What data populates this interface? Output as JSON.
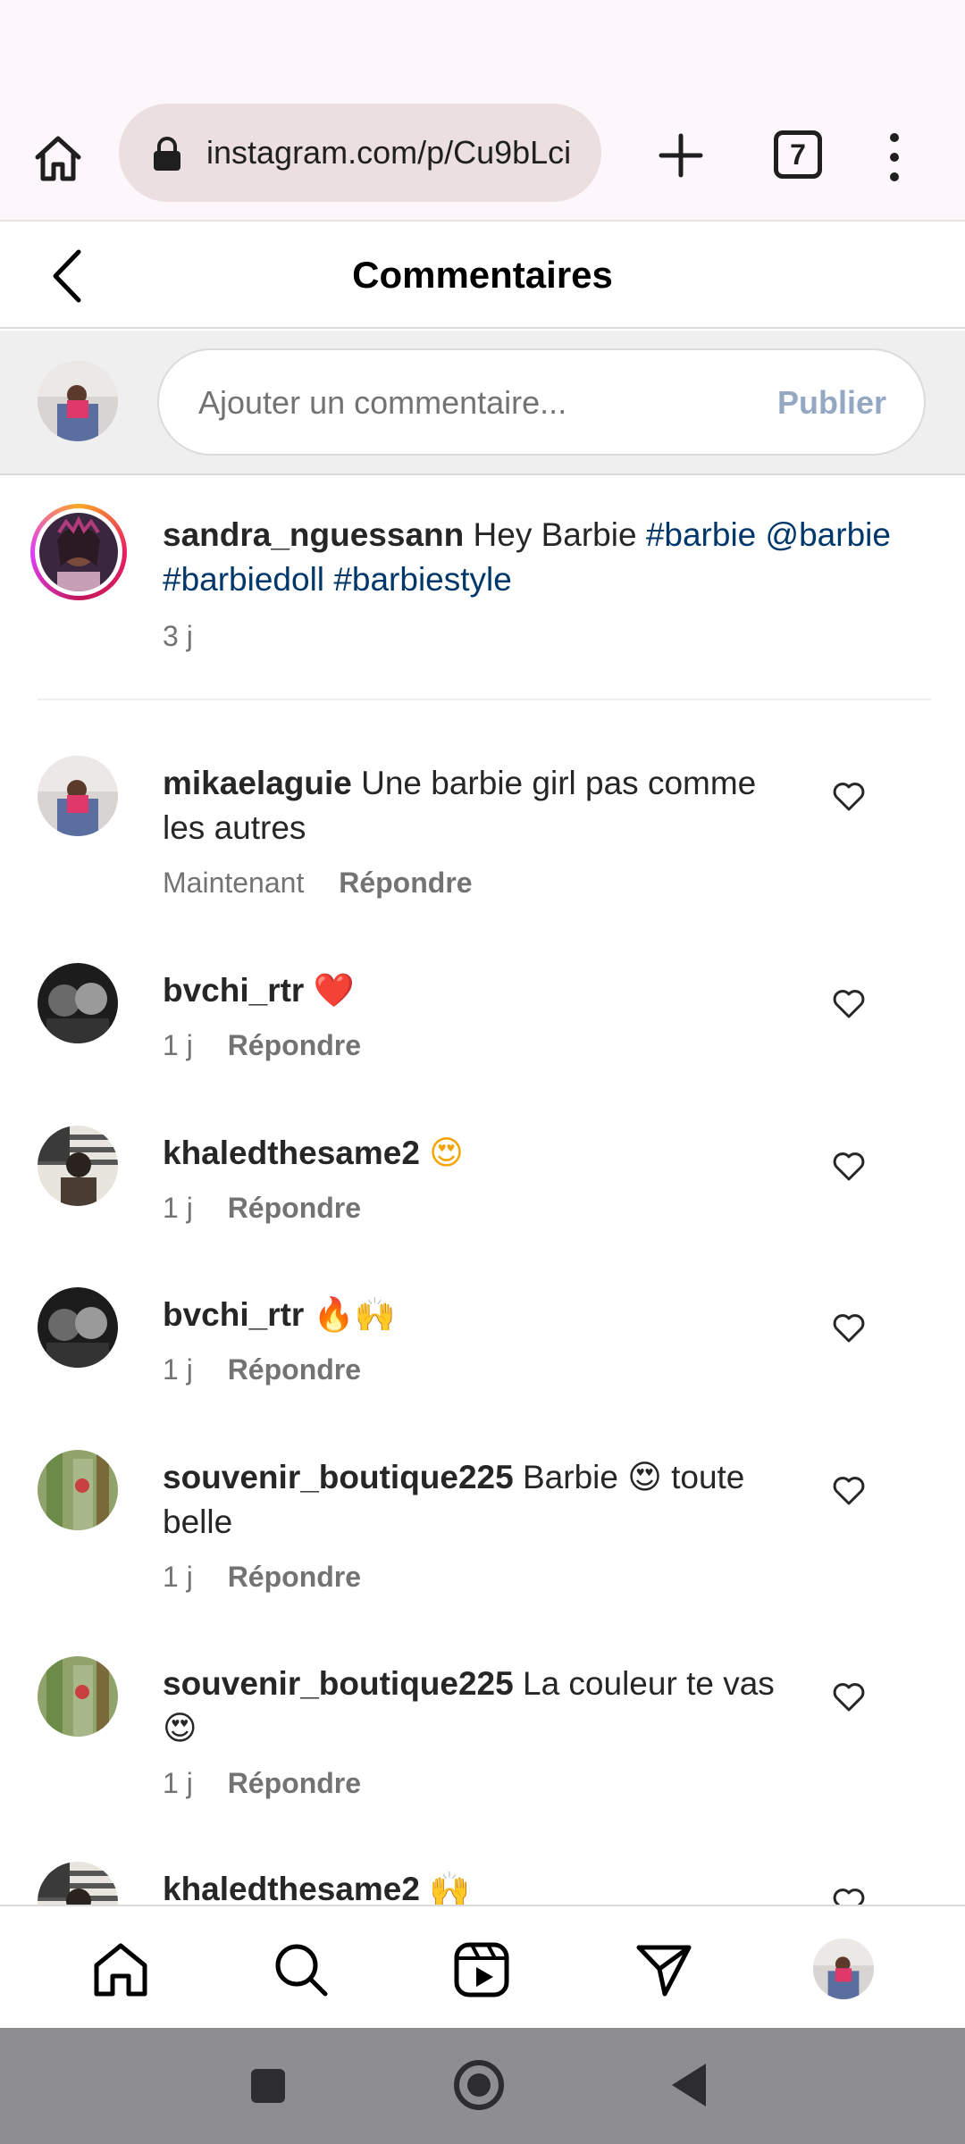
{
  "browser": {
    "url": "instagram.com/p/Cu9bLci",
    "tab_count": "7"
  },
  "header": {
    "title": "Commentaires"
  },
  "composer": {
    "placeholder": "Ajouter un commentaire...",
    "publish_label": "Publier"
  },
  "caption": {
    "username": "sandra_nguessann",
    "text": "Hey Barbie",
    "tags": [
      "#barbie",
      "@barbie",
      "#barbiedoll",
      "#barbiestyle"
    ],
    "time": "3 j"
  },
  "comments": [
    {
      "username": "mikaelaguie",
      "text": "Une barbie girl pas comme les autres",
      "time": "Maintenant",
      "reply": "Répondre"
    },
    {
      "username": "bvchi_rtr",
      "text": "❤️",
      "time": "1 j",
      "reply": "Répondre"
    },
    {
      "username": "khaledthesame2",
      "text": "😍",
      "time": "1 j",
      "reply": "Répondre"
    },
    {
      "username": "bvchi_rtr",
      "text": "🔥🙌",
      "time": "1 j",
      "reply": "Répondre"
    },
    {
      "username": "souvenir_boutique225",
      "text": "Barbie 😍 toute belle",
      "time": "1 j",
      "reply": "Répondre"
    },
    {
      "username": "souvenir_boutique225",
      "text": "La couleur te vas 😍",
      "time": "1 j",
      "reply": "Répondre"
    },
    {
      "username": "khaledthesame2",
      "text": "🙌",
      "time": "",
      "reply": ""
    }
  ],
  "colors": {
    "hashtag": "#00376b",
    "publish_disabled": "#94a8c4",
    "muted": "#737373"
  }
}
